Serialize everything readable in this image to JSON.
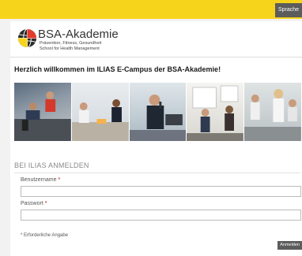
{
  "header": {
    "language_label": "Sprache"
  },
  "logo": {
    "name": "BSA-Akademie",
    "tagline_1": "Prävention, Fitness, Gesundheit",
    "tagline_2": "School for Health Management"
  },
  "welcome": {
    "title": "Herzlich willkommen im ILIAS E-Campus der BSA-Akademie!"
  },
  "banner": {
    "photos": [
      {
        "icon": "training-photo"
      },
      {
        "icon": "meeting-photo"
      },
      {
        "icon": "call-center-photo"
      },
      {
        "icon": "presentation-photo"
      },
      {
        "icon": "fitness-photo"
      }
    ]
  },
  "login": {
    "section_title": "BEI ILIAS ANMELDEN",
    "username_label": "Benutzername",
    "password_label": "Passwort",
    "required_marker": "*",
    "required_note": "* Erforderliche Angabe",
    "submit_label": "Anmelden"
  },
  "colors": {
    "accent": "#f7d41c",
    "button": "#5c5c5c"
  }
}
